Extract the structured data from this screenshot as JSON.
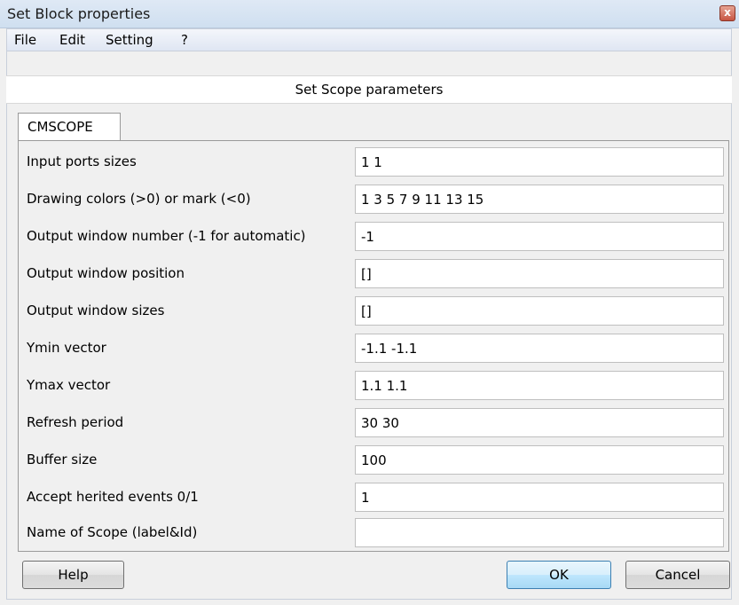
{
  "window": {
    "title": "Set Block properties",
    "close_glyph": "x"
  },
  "menu": [
    "File",
    "Edit",
    "Setting",
    "?"
  ],
  "heading": "Set Scope parameters",
  "tab": "CMSCOPE",
  "fields": [
    {
      "label": "Input ports sizes",
      "value": "1 1"
    },
    {
      "label": "Drawing colors (>0) or mark (<0)",
      "value": "1 3 5 7 9 11 13 15"
    },
    {
      "label": "Output window number (-1 for automatic)",
      "value": "-1"
    },
    {
      "label": "Output window position",
      "value": "[]"
    },
    {
      "label": "Output window sizes",
      "value": "[]"
    },
    {
      "label": "Ymin vector",
      "value": "-1.1 -1.1"
    },
    {
      "label": "Ymax vector",
      "value": "1.1 1.1"
    },
    {
      "label": "Refresh period",
      "value": "30 30"
    },
    {
      "label": "Buffer size",
      "value": "100"
    },
    {
      "label": "Accept herited events 0/1",
      "value": "1"
    },
    {
      "label": "Name of Scope (label&Id)",
      "value": ""
    }
  ],
  "buttons": {
    "help": "Help",
    "ok": "OK",
    "cancel": "Cancel"
  },
  "colors": {
    "close_button": "#c75542",
    "default_button": "#bee6fd"
  },
  "icons": {
    "close": "close-icon"
  }
}
